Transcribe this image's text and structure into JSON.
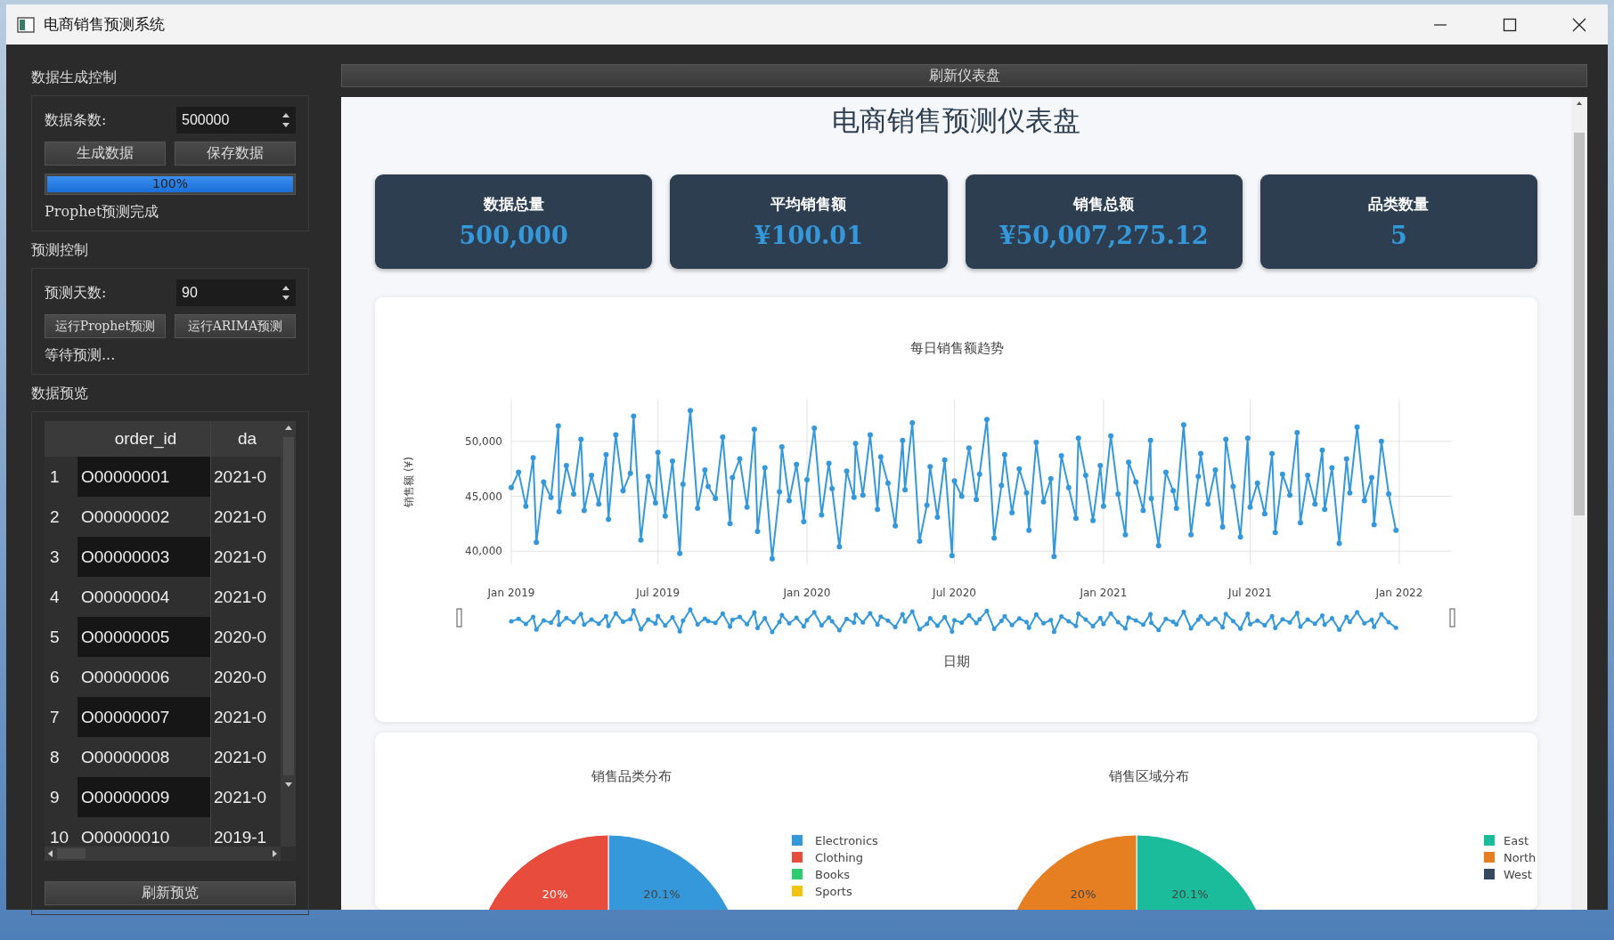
{
  "window": {
    "title": "电商销售预测系统"
  },
  "sidebar": {
    "generation": {
      "title": "数据生成控制",
      "count_label": "数据条数:",
      "count_value": "500000",
      "buttons": [
        "生成数据",
        "保存数据"
      ],
      "progress": {
        "level": 1,
        "text": "100%"
      },
      "status": "Prophet预测完成"
    },
    "forecast": {
      "title": "预测控制",
      "days_label": "预测天数:",
      "days_value": "90",
      "buttons": [
        "运行Prophet预测",
        "运行ARIMA预测"
      ],
      "status": "等待预测..."
    },
    "preview": {
      "title": "数据预览",
      "columns": [
        "order_id",
        "da"
      ],
      "rows": [
        {
          "row_number": "1",
          "order_id": "O00000001",
          "column_2": "2021-0"
        },
        {
          "row_number": "2",
          "order_id": "O00000002",
          "column_2": "2021-0"
        },
        {
          "row_number": "3",
          "order_id": "O00000003",
          "column_2": "2021-0"
        },
        {
          "row_number": "4",
          "order_id": "O00000004",
          "column_2": "2021-0"
        },
        {
          "row_number": "5",
          "order_id": "O00000005",
          "column_2": "2020-0"
        },
        {
          "row_number": "6",
          "order_id": "O00000006",
          "column_2": "2020-0"
        },
        {
          "row_number": "7",
          "order_id": "O00000007",
          "column_2": "2021-0"
        },
        {
          "row_number": "8",
          "order_id": "O00000008",
          "column_2": "2021-0"
        },
        {
          "row_number": "9",
          "order_id": "O00000009",
          "column_2": "2021-0"
        },
        {
          "row_number": "10",
          "order_id": "O00000010",
          "column_2": "2019-1"
        }
      ],
      "refresh_button": "刷新预览"
    }
  },
  "dashboard": {
    "refresh_button": "刷新仪表盘",
    "title": "电商销售预测仪表盘",
    "stats": [
      {
        "label": "数据总量",
        "value": "500,000"
      },
      {
        "label": "平均销售额",
        "value": "¥100.01"
      },
      {
        "label": "销售总额",
        "value": "¥50,007,275.12"
      },
      {
        "label": "品类数量",
        "value": "5"
      }
    ],
    "trend": {
      "chart_data": {
        "type": "line",
        "title": "每日销售额趋势",
        "xlabel": "日期",
        "ylabel": "销售额 (¥)",
        "grid": true,
        "xlim": [
          "2019-01-01",
          "2022-03-07"
        ],
        "ylim": [
          38800,
          53800
        ],
        "xticks": [
          {
            "value": "2019-01-01",
            "label": "Jan 2019"
          },
          {
            "value": "2019-07-01",
            "label": "Jul 2019"
          },
          {
            "value": "2020-01-01",
            "label": "Jan 2020"
          },
          {
            "value": "2020-07-01",
            "label": "Jul 2020"
          },
          {
            "value": "2021-01-01",
            "label": "Jan 2021"
          },
          {
            "value": "2021-07-01",
            "label": "Jul 2021"
          },
          {
            "value": "2022-01-01",
            "label": "Jan 2022"
          }
        ],
        "yticks": [
          {
            "value": 40000,
            "label": "40,000"
          },
          {
            "value": 45000,
            "label": "45,000"
          },
          {
            "value": 50000,
            "label": "50,000"
          }
        ],
        "x": [
          "2019-01-01",
          "2019-01-10",
          "2019-01-19",
          "2019-01-28",
          "2019-02-01",
          "2019-02-10",
          "2019-02-19",
          "2019-02-28",
          "2019-03-01",
          "2019-03-10",
          "2019-03-19",
          "2019-03-28",
          "2019-04-01",
          "2019-04-10",
          "2019-04-19",
          "2019-04-28",
          "2019-05-01",
          "2019-05-10",
          "2019-05-19",
          "2019-05-28",
          "2019-06-01",
          "2019-06-10",
          "2019-06-19",
          "2019-06-28",
          "2019-07-01",
          "2019-07-10",
          "2019-07-19",
          "2019-07-28",
          "2019-08-01",
          "2019-08-10",
          "2019-08-19",
          "2019-08-28",
          "2019-09-01",
          "2019-09-10",
          "2019-09-19",
          "2019-09-28",
          "2019-10-01",
          "2019-10-10",
          "2019-10-19",
          "2019-10-28",
          "2019-11-01",
          "2019-11-10",
          "2019-11-19",
          "2019-11-28",
          "2019-12-01",
          "2019-12-10",
          "2019-12-19",
          "2019-12-28",
          "2020-01-01",
          "2020-01-10",
          "2020-01-19",
          "2020-01-28",
          "2020-02-01",
          "2020-02-10",
          "2020-02-19",
          "2020-02-28",
          "2020-03-01",
          "2020-03-10",
          "2020-03-19",
          "2020-03-28",
          "2020-04-01",
          "2020-04-10",
          "2020-04-19",
          "2020-04-28",
          "2020-05-01",
          "2020-05-10",
          "2020-05-19",
          "2020-05-28",
          "2020-06-01",
          "2020-06-10",
          "2020-06-19",
          "2020-06-28",
          "2020-07-01",
          "2020-07-10",
          "2020-07-19",
          "2020-07-28",
          "2020-08-01",
          "2020-08-10",
          "2020-08-19",
          "2020-08-28",
          "2020-09-01",
          "2020-09-10",
          "2020-09-19",
          "2020-09-28",
          "2020-10-01",
          "2020-10-10",
          "2020-10-19",
          "2020-10-28",
          "2020-11-01",
          "2020-11-10",
          "2020-11-19",
          "2020-11-28",
          "2020-12-01",
          "2020-12-10",
          "2020-12-19",
          "2020-12-28",
          "2021-01-01",
          "2021-01-10",
          "2021-01-19",
          "2021-01-28",
          "2021-02-01",
          "2021-02-10",
          "2021-02-19",
          "2021-02-28",
          "2021-03-01",
          "2021-03-10",
          "2021-03-19",
          "2021-03-28",
          "2021-04-01",
          "2021-04-10",
          "2021-04-19",
          "2021-04-28",
          "2021-05-01",
          "2021-05-10",
          "2021-05-19",
          "2021-05-28",
          "2021-06-01",
          "2021-06-10",
          "2021-06-19",
          "2021-06-28",
          "2021-07-01",
          "2021-07-10",
          "2021-07-19",
          "2021-07-28",
          "2021-08-01",
          "2021-08-10",
          "2021-08-19",
          "2021-08-28",
          "2021-09-01",
          "2021-09-10",
          "2021-09-19",
          "2021-09-28",
          "2021-10-01",
          "2021-10-10",
          "2021-10-19",
          "2021-10-28",
          "2021-11-01",
          "2021-11-10",
          "2021-11-19",
          "2021-11-28",
          "2021-12-01",
          "2021-12-10",
          "2021-12-19",
          "2021-12-28"
        ],
        "series": [
          {
            "color": "#3498db",
            "marker": true,
            "values": [
              45800,
              47200,
              44100,
              48500,
              40800,
              46300,
              44900,
              51400,
              43600,
              47800,
              45200,
              50200,
              43700,
              46900,
              44300,
              48800,
              42900,
              50600,
              45500,
              47100,
              52300,
              41000,
              46800,
              44400,
              49000,
              43200,
              48200,
              39800,
              46100,
              52800,
              43900,
              47400,
              45900,
              44800,
              50400,
              42500,
              46700,
              48400,
              44000,
              51100,
              41800,
              47600,
              39300,
              45400,
              49500,
              44600,
              47900,
              42700,
              46500,
              51200,
              43300,
              48000,
              45700,
              40400,
              47300,
              44900,
              49800,
              45100,
              50600,
              43800,
              48600,
              46200,
              42300,
              50100,
              45600,
              51700,
              40900,
              44200,
              47700,
              43100,
              48300,
              39600,
              46400,
              45000,
              49400,
              44700,
              47000,
              52000,
              41200,
              46000,
              48800,
              43500,
              47500,
              45300,
              41900,
              49900,
              44500,
              46600,
              39500,
              48700,
              45800,
              43000,
              50300,
              46900,
              42800,
              47800,
              44100,
              50500,
              45200,
              41500,
              48100,
              46300,
              43700,
              50100,
              44800,
              40500,
              47200,
              45500,
              43900,
              51500,
              41500,
              46800,
              48900,
              44300,
              47400,
              42200,
              50200,
              45900,
              41300,
              50300,
              44000,
              46200,
              43400,
              48900,
              41700,
              47000,
              45100,
              50800,
              42600,
              46900,
              44300,
              49200,
              43800,
              47600,
              40700,
              48400,
              45300,
              51300,
              44600,
              46700,
              42400,
              50000,
              45200,
              41900
            ]
          }
        ]
      }
    },
    "pies": [
      {
        "chart_data": {
          "type": "pie",
          "title": "销售品类分布",
          "categories": [
            "Electronics",
            "Clothing",
            "Books",
            "Sports"
          ],
          "values": [
            20.1,
            20,
            null,
            null
          ],
          "colors": [
            "#3498db",
            "#e74c3c",
            "#2ecc71",
            "#f1c40f"
          ],
          "value_labels": [
            "20.1%",
            "20%",
            null,
            null
          ],
          "legend": true
        }
      },
      {
        "chart_data": {
          "type": "pie",
          "title": "销售区域分布",
          "categories": [
            "East",
            "North",
            "West"
          ],
          "values": [
            20.1,
            20,
            null
          ],
          "colors": [
            "#1abc9c",
            "#e67e22",
            "#34495e"
          ],
          "value_labels": [
            "20.1%",
            "20%",
            null
          ],
          "legend": true
        }
      }
    ]
  }
}
